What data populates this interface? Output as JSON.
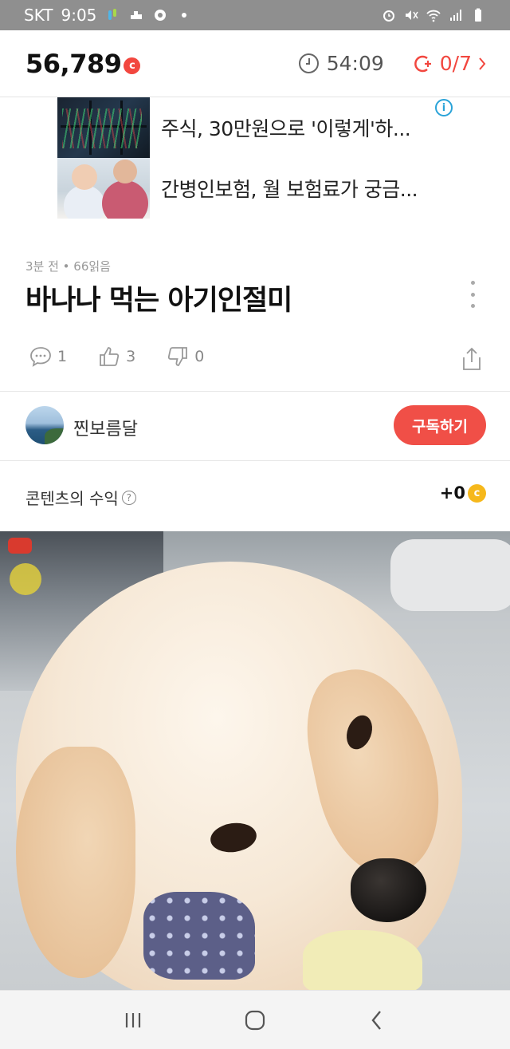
{
  "status_bar": {
    "carrier": "SKT",
    "time": "9:05"
  },
  "header": {
    "points": "56,789",
    "points_badge": "c",
    "timer": "54:09",
    "quota": "0/7"
  },
  "ads": {
    "items": [
      {
        "text": "주식, 30만원으로 '이렇게'하...",
        "thumb": "stock-monitors"
      },
      {
        "text": "간병인보험, 월 보험료가 궁금...",
        "thumb": "caregiver"
      }
    ],
    "info_icon": "i"
  },
  "article": {
    "meta": "3분 전 • 66읽음",
    "title": "바나나 먹는 아기인절미",
    "comments": "1",
    "likes": "3",
    "dislikes": "0"
  },
  "author": {
    "name": "찐보름달",
    "subscribe_label": "구독하기"
  },
  "revenue": {
    "label": "콘텐츠의 수익",
    "help_icon": "?",
    "value": "+0",
    "coin": "c"
  },
  "colors": {
    "accent_red": "#f04f47",
    "coin_gold": "#f6b81b",
    "status_bar_bg": "#8f8f8f"
  }
}
